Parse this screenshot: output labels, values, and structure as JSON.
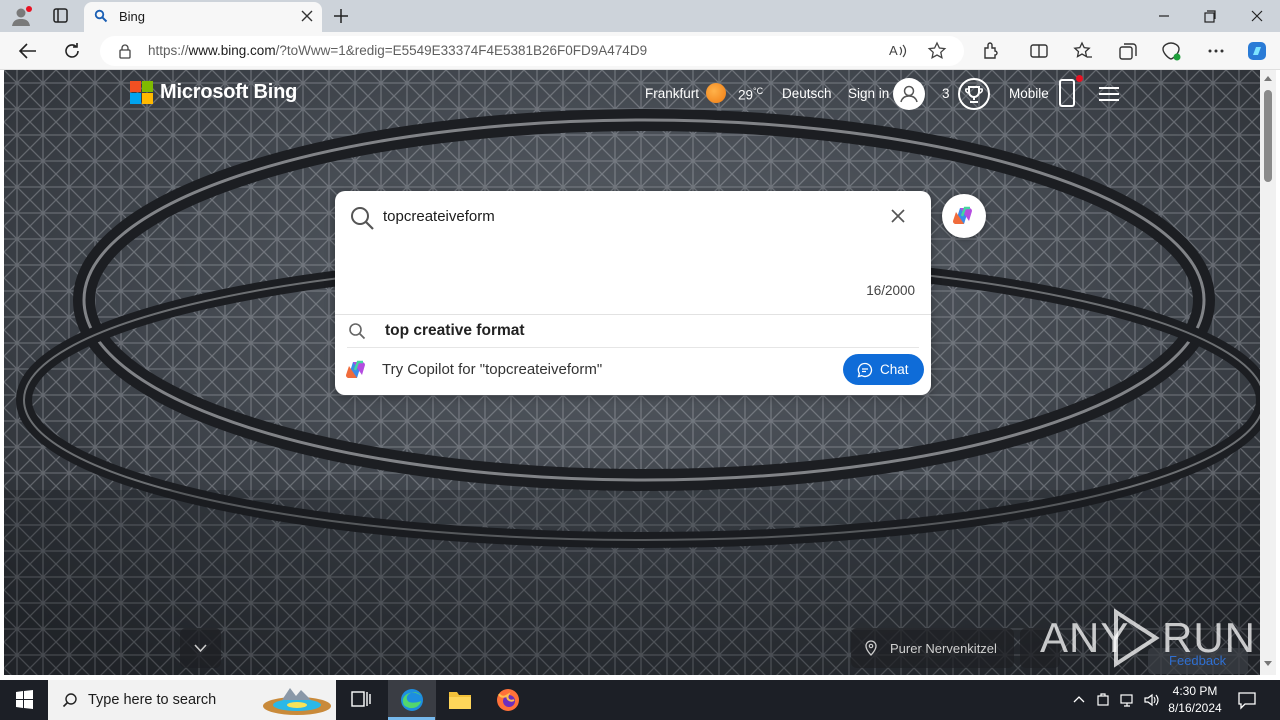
{
  "browser": {
    "tab_title": "Bing",
    "url_prefix": "https://",
    "url_domain": "www.bing.com",
    "url_rest": "/?toWww=1&redig=E5549E33374F4E5381B26F0FD9A474D9"
  },
  "bing": {
    "logo_text": "Microsoft Bing",
    "city": "Frankfurt",
    "temperature": "29",
    "temp_unit": "°C",
    "language": "Deutsch",
    "sign_in": "Sign in",
    "rewards_count": "3",
    "mobile": "Mobile",
    "search_query": "topcreateiveform",
    "char_count": "16/2000",
    "suggestion": "top creative format",
    "copilot_prompt": "Try Copilot for \"topcreateiveform\"",
    "chat_label": "Chat",
    "image_title": "Purer Nervenkitzel",
    "feedback": "Feedback",
    "watermark_left": "ANY",
    "watermark_right": "RUN"
  },
  "taskbar": {
    "search_placeholder": "Type here to search",
    "time": "4:30 PM",
    "date": "8/16/2024"
  },
  "colors": {
    "tab_bar": "#cdd3da",
    "toolbar": "#f7f7f7",
    "chat_button": "#0f6cd8",
    "taskbar": "#1c1f26",
    "bing_red": "#f25022",
    "bing_green": "#7fba00",
    "bing_blue": "#00a4ef",
    "bing_yellow": "#ffb900"
  }
}
